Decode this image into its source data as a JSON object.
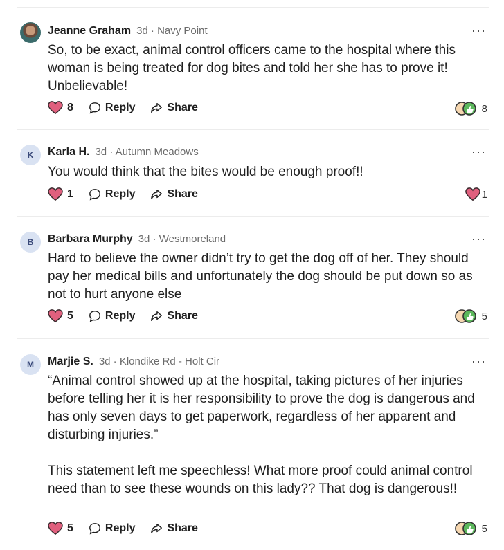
{
  "comments": [
    {
      "avatar_initial": "",
      "name": "Jeanne Graham",
      "meta": "3d · Navy Point",
      "more": "···",
      "paragraphs": [
        "So, to be exact, animal control officers came to the hospital where this woman is being treated for dog bites and told her she has to prove it! Unbelievable!"
      ],
      "like_count": "8",
      "reply_label": "Reply",
      "share_label": "Share",
      "reaction_total": "8"
    },
    {
      "avatar_initial": "K",
      "name": "Karla H.",
      "meta": "3d · Autumn Meadows",
      "more": "···",
      "paragraphs": [
        "You would think that the bites would be enough proof!!"
      ],
      "like_count": "1",
      "reply_label": "Reply",
      "share_label": "Share",
      "reaction_total": "1"
    },
    {
      "avatar_initial": "B",
      "name": "Barbara Murphy",
      "meta": "3d · Westmoreland",
      "more": "···",
      "paragraphs": [
        "Hard to believe the owner didn’t try to get the dog off of her.  They should pay her medical bills and unfortunately the dog should be put down so as not to hurt anyone else"
      ],
      "like_count": "5",
      "reply_label": "Reply",
      "share_label": "Share",
      "reaction_total": "5"
    },
    {
      "avatar_initial": "M",
      "name": "Marjie S.",
      "meta": "3d · Klondike Rd - Holt Cir",
      "more": "···",
      "paragraphs": [
        "“Animal control showed up at the hospital, taking pictures of her injuries before telling her it is her responsibility to prove the dog is dangerous and has only seven days to get paperwork, regardless of her apparent and disturbing injuries.”",
        "This statement left me speechless!  What more proof could animal control need than to see these wounds on this lady??  That dog is dangerous!!"
      ],
      "like_count": "5",
      "reply_label": "Reply",
      "share_label": "Share",
      "reaction_total": "5"
    }
  ],
  "colors": {
    "heart": "#e0607e",
    "heart_stroke": "#3a2a2e",
    "thumb": "#5cb85c",
    "ring": "#f0a85a"
  }
}
